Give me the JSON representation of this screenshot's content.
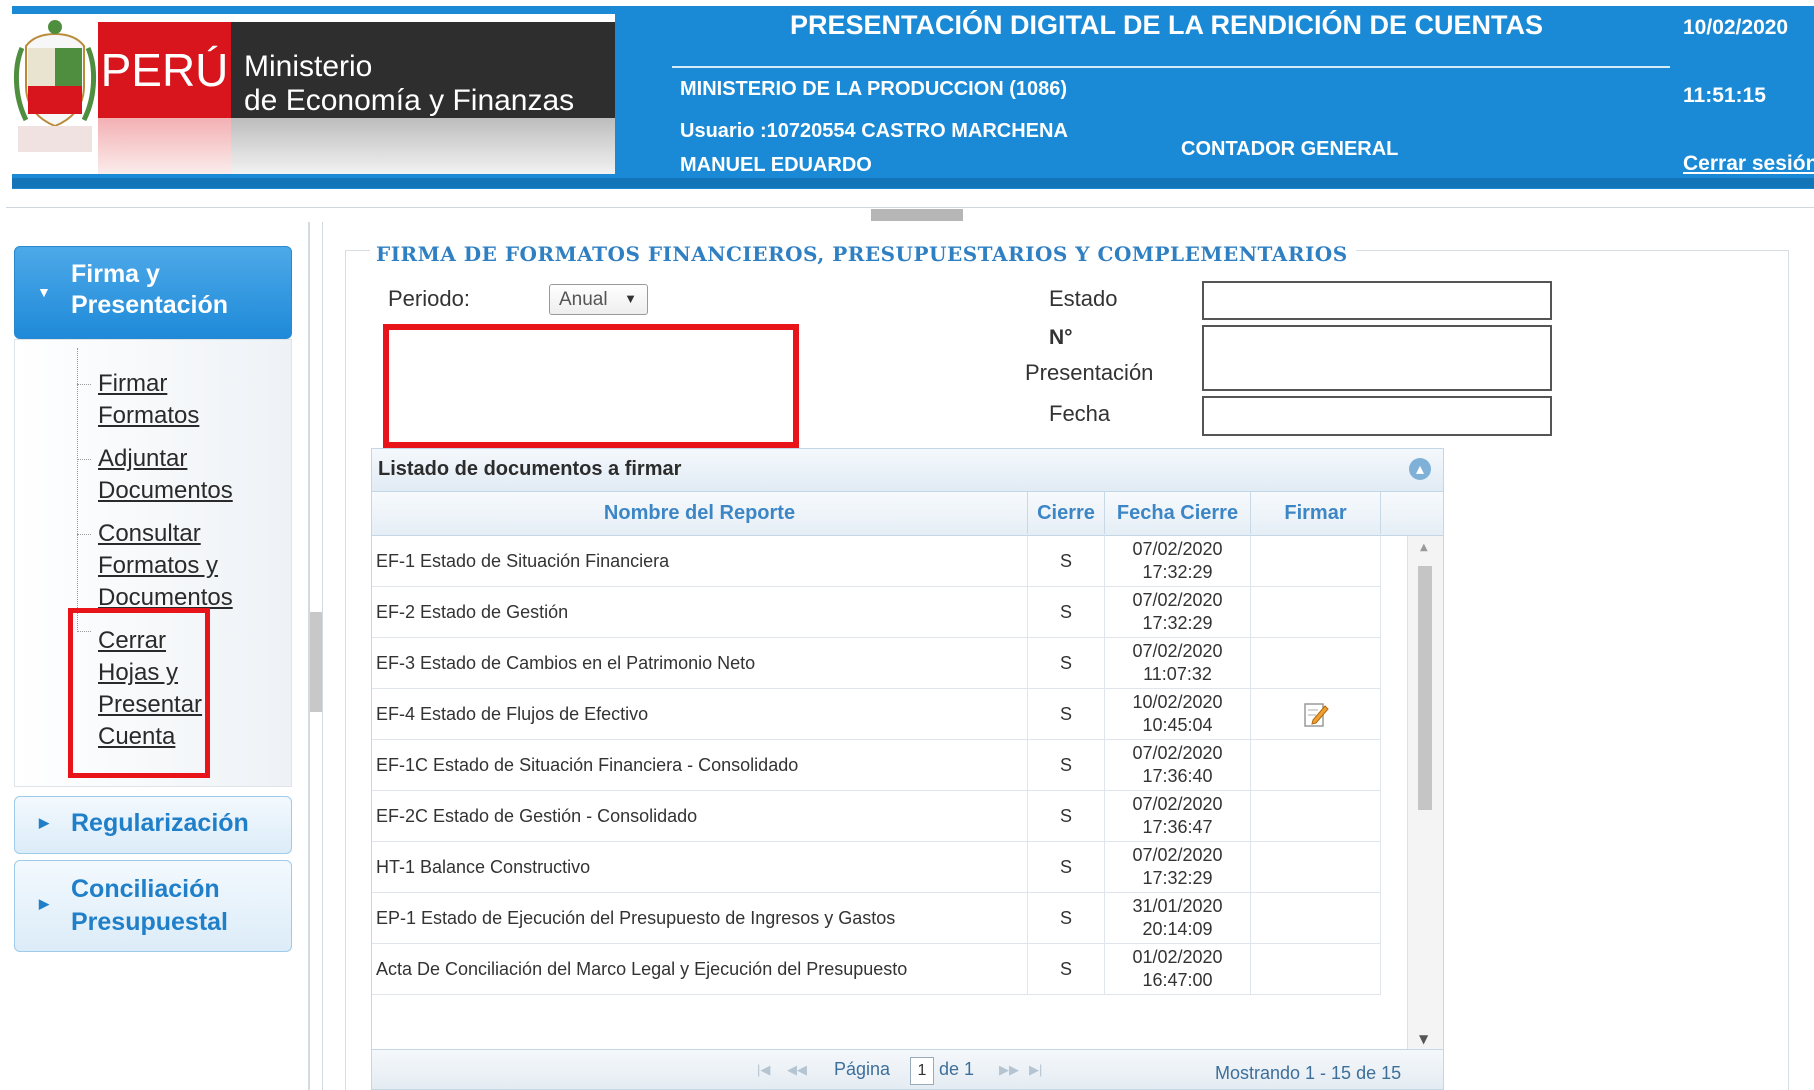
{
  "header": {
    "brand_peru": "PERÚ",
    "brand_ministry_line1": "Ministerio",
    "brand_ministry_line2": "de Economía y Finanzas",
    "app_title": "PRESENTACIÓN DIGITAL DE LA RENDICIÓN DE CUENTAS",
    "date": "10/02/2020",
    "time": "11:51:15",
    "logout": "Cerrar sesión",
    "entity": "MINISTERIO DE LA PRODUCCION (1086)",
    "user_line1": "Usuario :10720554 CASTRO MARCHENA",
    "user_line2": "MANUEL EDUARDO",
    "role": "CONTADOR GENERAL",
    "colors": {
      "header_bg": "#1a8ad6",
      "peru_red": "#d8141c",
      "ministry_dark": "#2e2e2e"
    }
  },
  "sidebar": {
    "sections": [
      {
        "label_line1": "Firma y",
        "label_line2": "Presentación",
        "expanded": true
      },
      {
        "label_line1": "Regularización",
        "expanded": false
      },
      {
        "label_line1": "Conciliación",
        "label_line2": "Presupuestal",
        "expanded": false
      }
    ],
    "items": [
      {
        "lines": [
          "Firmar",
          "Formatos"
        ]
      },
      {
        "lines": [
          "Adjuntar",
          "Documentos"
        ]
      },
      {
        "lines": [
          "Consultar",
          "Formatos y",
          "Documentos"
        ]
      },
      {
        "lines": [
          "Cerrar",
          "Hojas y",
          "Presentar",
          "Cuenta"
        ]
      }
    ],
    "highlight_color": "#e8141a"
  },
  "main": {
    "section_title": "FIRMA DE FORMATOS FINANCIEROS, PRESUPUESTARIOS Y COMPLEMENTARIOS",
    "form": {
      "periodo_label": "Periodo:",
      "periodo_value": "Anual",
      "estado_label": "Estado",
      "nro_label": "N°",
      "presentacion_label": "Presentación",
      "fecha_label": "Fecha",
      "estado_value": "",
      "nro_value": "",
      "fecha_value": ""
    },
    "grid": {
      "caption": "Listado de documentos a firmar",
      "columns": [
        "Nombre del Reporte",
        "Cierre",
        "Fecha Cierre",
        "Firmar"
      ],
      "rows": [
        {
          "nombre": "EF-1 Estado de Situación Financiera",
          "cierre": "S",
          "fecha": "07/02/2020",
          "hora": "17:32:29",
          "firmar": false
        },
        {
          "nombre": "EF-2 Estado de Gestión",
          "cierre": "S",
          "fecha": "07/02/2020",
          "hora": "17:32:29",
          "firmar": false
        },
        {
          "nombre": "EF-3 Estado de Cambios en el Patrimonio Neto",
          "cierre": "S",
          "fecha": "07/02/2020",
          "hora": "11:07:32",
          "firmar": false
        },
        {
          "nombre": "EF-4 Estado de Flujos de Efectivo",
          "cierre": "S",
          "fecha": "10/02/2020",
          "hora": "10:45:04",
          "firmar": true
        },
        {
          "nombre": "EF-1C Estado de Situación Financiera - Consolidado",
          "cierre": "S",
          "fecha": "07/02/2020",
          "hora": "17:36:40",
          "firmar": false
        },
        {
          "nombre": "EF-2C Estado de Gestión - Consolidado",
          "cierre": "S",
          "fecha": "07/02/2020",
          "hora": "17:36:47",
          "firmar": false
        },
        {
          "nombre": "HT-1 Balance Constructivo",
          "cierre": "S",
          "fecha": "07/02/2020",
          "hora": "17:32:29",
          "firmar": false
        },
        {
          "nombre": "EP-1 Estado de Ejecución del Presupuesto de Ingresos y Gastos",
          "cierre": "S",
          "fecha": "31/01/2020",
          "hora": "20:14:09",
          "firmar": false
        },
        {
          "nombre": "Acta De Conciliación del Marco Legal y Ejecución del Presupuesto",
          "cierre": "S",
          "fecha": "01/02/2020",
          "hora": "16:47:00",
          "firmar": false
        }
      ],
      "pager": {
        "page_label": "Página",
        "page_value": "1",
        "of_label": "de 1",
        "summary": "Mostrando 1 - 15 de 15"
      }
    }
  }
}
